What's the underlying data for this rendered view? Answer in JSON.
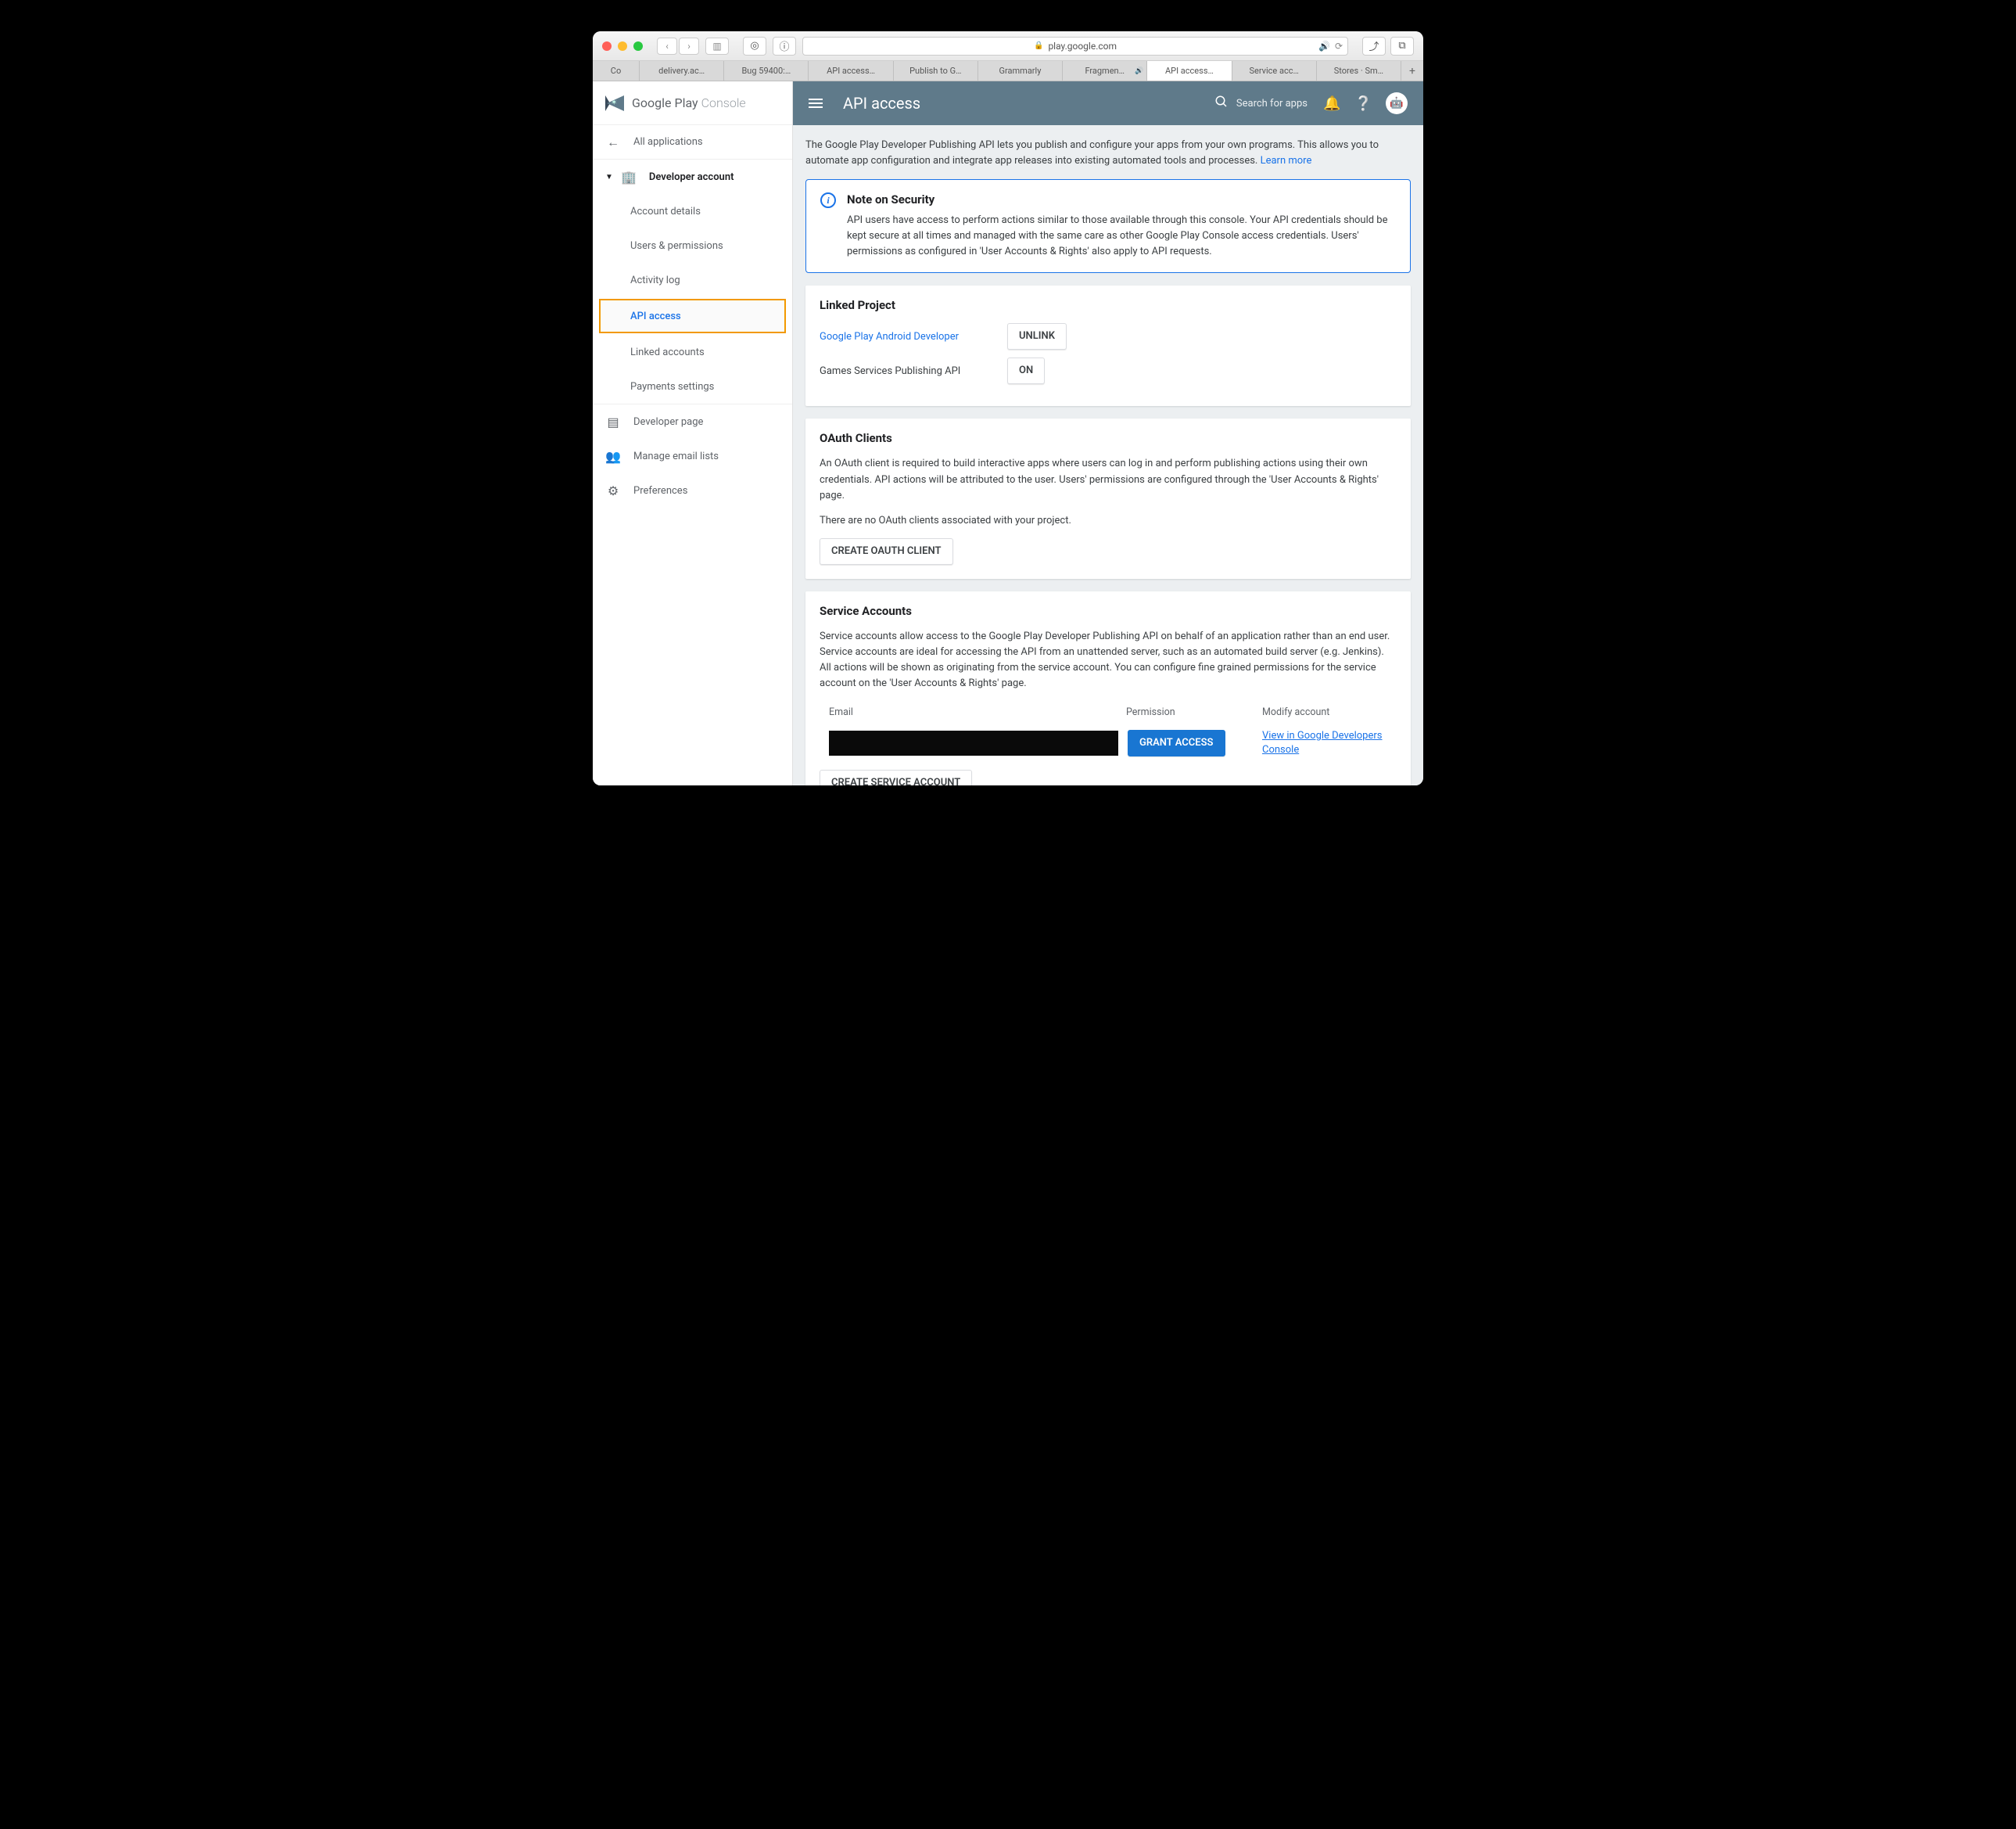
{
  "browser": {
    "url_host": "play.google.com",
    "tabs": [
      "Co",
      "delivery.ac…",
      "Bug 59400:…",
      "API access…",
      "Publish to G…",
      "Grammarly",
      "Fragmen…",
      "API access…",
      "Service acc…",
      "Stores · Sm…"
    ],
    "active_tab_index": 7,
    "audio_tab_index": 6
  },
  "logo": {
    "text_strong": "Google Play",
    "text_light": "Console"
  },
  "header": {
    "title": "API access",
    "search_placeholder": "Search for apps"
  },
  "sidebar": {
    "all_apps": "All applications",
    "section": "Developer account",
    "items": [
      "Account details",
      "Users & permissions",
      "Activity log",
      "API access",
      "Linked accounts",
      "Payments settings"
    ],
    "active_index": 3,
    "bottom": [
      "Developer page",
      "Manage email lists",
      "Preferences"
    ]
  },
  "intro": {
    "text": "The Google Play Developer Publishing API lets you publish and configure your apps from your own programs. This allows you to automate app configuration and integrate app releases into existing automated tools and processes. ",
    "learn_more": "Learn more"
  },
  "notice": {
    "title": "Note on Security",
    "body": "API users have access to perform actions similar to those available through this console. Your API credentials should be kept secure at all times and managed with the same care as other Google Play Console access credentials. Users' permissions as configured in 'User Accounts & Rights' also apply to API requests."
  },
  "linked_project": {
    "heading": "Linked Project",
    "row1_label": "Google Play Android Developer",
    "row1_button": "Unlink",
    "row2_label": "Games Services Publishing API",
    "row2_button": "On"
  },
  "oauth": {
    "heading": "OAuth Clients",
    "p1": "An OAuth client is required to build interactive apps where users can log in and perform publishing actions using their own credentials. API actions will be attributed to the user. Users' permissions are configured through the 'User Accounts & Rights' page.",
    "p2": "There are no OAuth clients associated with your project.",
    "button": "Create OAuth Client"
  },
  "service": {
    "heading": "Service Accounts",
    "p1": "Service accounts allow access to the Google Play Developer Publishing API on behalf of an application rather than an end user. Service accounts are ideal for accessing the API from an unattended server, such as an automated build server (e.g. Jenkins). All actions will be shown as originating from the service account. You can configure fine grained permissions for the service account on the 'User Accounts & Rights' page.",
    "col_email": "Email",
    "col_perm": "Permission",
    "col_mod": "Modify account",
    "grant_button": "Grant Access",
    "view_link": "View in Google Developers Console",
    "create_button": "Create Service Account"
  }
}
